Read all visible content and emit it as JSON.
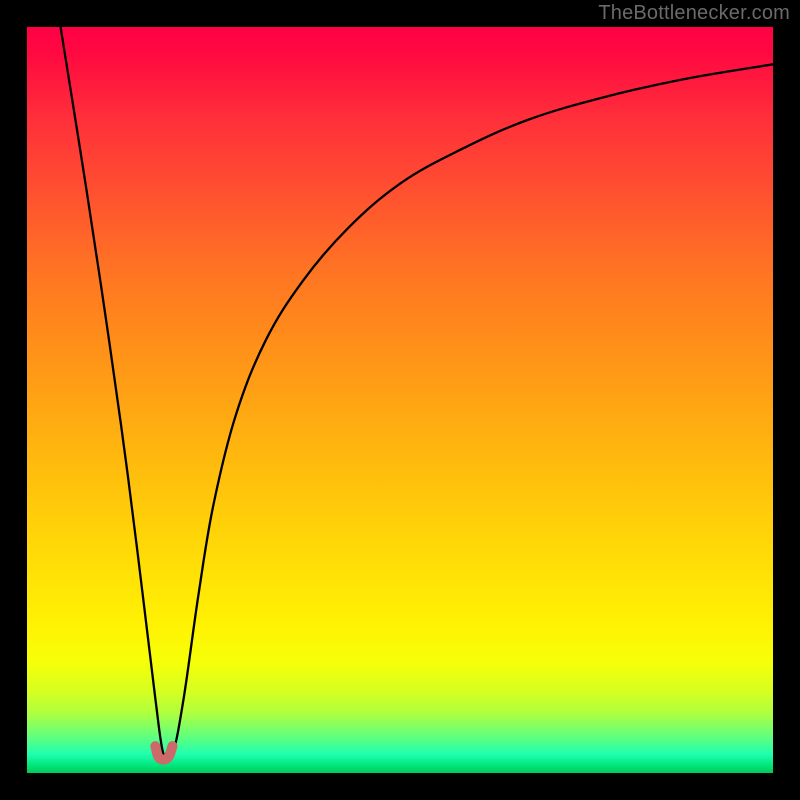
{
  "watermark": "TheBottlenecker.com",
  "chart_data": {
    "type": "line",
    "title": "",
    "xlabel": "",
    "ylabel": "",
    "xlim": [
      0,
      100
    ],
    "ylim": [
      0,
      100
    ],
    "grid": false,
    "background_gradient": {
      "direction": "vertical",
      "meaning": "bottleneck severity (top red = high, bottom green = zero)",
      "stops": [
        {
          "pos": 0.0,
          "color": "#ff0044"
        },
        {
          "pos": 0.5,
          "color": "#ffb40f"
        },
        {
          "pos": 0.8,
          "color": "#fff203"
        },
        {
          "pos": 0.95,
          "color": "#7dff68"
        },
        {
          "pos": 1.0,
          "color": "#00c95a"
        }
      ]
    },
    "series": [
      {
        "name": "bottleneck-curve",
        "color": "#000000",
        "x": [
          4.5,
          8,
          11,
          13.5,
          15.5,
          17.2,
          18.3,
          19.5,
          21,
          23,
          25,
          28,
          32,
          37,
          43,
          50,
          58,
          67,
          77,
          88,
          100
        ],
        "y": [
          100,
          78,
          58,
          40,
          24,
          10,
          2.5,
          2.5,
          10,
          24,
          36,
          48,
          58,
          66,
          73,
          79,
          83.5,
          87.5,
          90.5,
          93,
          95
        ]
      },
      {
        "name": "minimum-marker",
        "color": "#cc6a6a",
        "x": [
          17.2,
          17.6,
          18.3,
          19.0,
          19.5
        ],
        "y": [
          3.6,
          2.2,
          1.8,
          2.2,
          3.6
        ]
      }
    ],
    "notes": "No axis ticks or numeric labels are rendered in the image; x/y values are positional estimates on a 0–100 normalized scale derived from pixel positions."
  }
}
